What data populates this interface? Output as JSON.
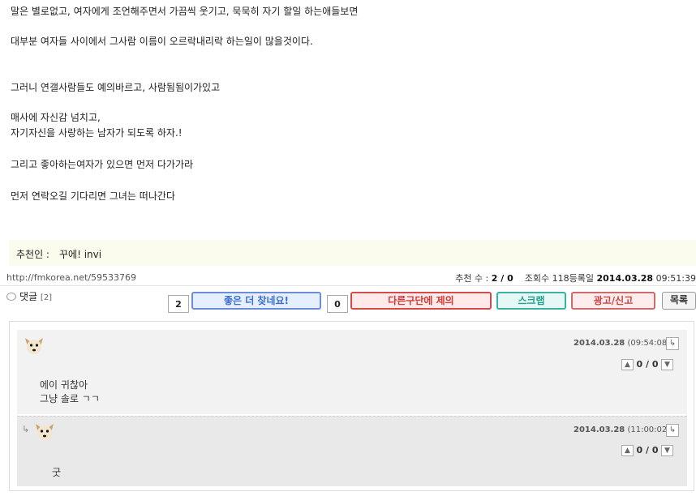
{
  "article": {
    "lines": [
      "말은 별로없고, 여자에게 조언해주면서 가끔씩 웃기고, 묵묵히 자기 할일 하는애들보면",
      "대부분 여자들 사이에서 그사람 이름이 오르락내리락 하는일이 많을것이다.",
      "그러니 연갤사람들도 예의바르고, 사람됨됨이가있고",
      "매사에 자신감 넘치고,",
      "자기자신을 사랑하는 남자가 되도록 하자.!",
      "그리고 좋아하는여자가 있으면  먼저 다가가라",
      "먼저 연락오길 기다리면 그녀는 떠나간다"
    ]
  },
  "recommenders": {
    "label": "추천인 :",
    "names": "꾸에!  invi"
  },
  "meta": {
    "url": "http://fmkorea.net/59533769",
    "recommend_label": "추천 수 :",
    "recommend_value": "2 / 0",
    "views_label": "조회수",
    "views_value": "118",
    "date_label": "등록일",
    "date_value": "2014.03.28",
    "time_value": "09:51:39"
  },
  "comment_section": {
    "title": "댓글",
    "count": "[2]"
  },
  "actions": {
    "good_count": "2",
    "good_label": "좋은 더 찾네요!",
    "bad_count": "0",
    "bad_label": "다른구단에 제의",
    "scrap_label": "스크랩",
    "report_label": "광고/신고",
    "list_label": "목록"
  },
  "comments": [
    {
      "date": "2014.03.28",
      "time": "(09:54:08)",
      "votes": "0 / 0",
      "lines": [
        "에이 귀찮아",
        "그냥 솔로 ㄱㄱ"
      ]
    },
    {
      "date": "2014.03.28",
      "time": "(11:00:02)",
      "votes": "0 / 0",
      "lines": [
        "굿"
      ]
    }
  ],
  "icons": {
    "avatar": "dog-face-icon",
    "reply": "reply-arrow-icon",
    "thumb_up": "thumb-up-icon",
    "thumb_down": "thumb-down-icon",
    "speech": "speech-bubble-icon"
  }
}
